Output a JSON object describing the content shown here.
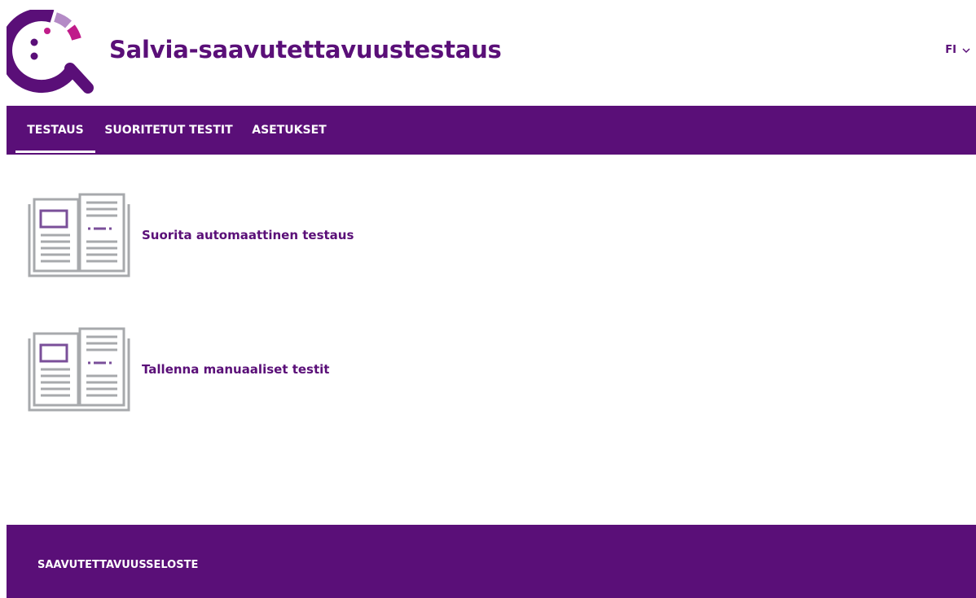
{
  "header": {
    "title": "Salvia-saavutettavuustestaus",
    "logo_icon": "magnifier-logo-icon",
    "language": {
      "selected": "FI",
      "icon": "chevron-down-icon"
    }
  },
  "nav": {
    "tabs": [
      {
        "label": "TESTAUS",
        "active": true
      },
      {
        "label": "SUORITETUT TESTIT",
        "active": false
      },
      {
        "label": "ASETUKSET",
        "active": false
      }
    ]
  },
  "main": {
    "cards": [
      {
        "label": "Suorita automaattinen testaus",
        "icon": "open-book-icon"
      },
      {
        "label": "Tallenna manuaaliset testit",
        "icon": "open-book-icon"
      }
    ]
  },
  "footer": {
    "link_label": "SAAVUTETTAVUUSSELOSTE"
  },
  "colors": {
    "brand": "#5a0f78",
    "accent_pink": "#c01c8a",
    "accent_lilac": "#b48bc6",
    "icon_gray": "#a7a9ac",
    "background": "#ffffff"
  }
}
